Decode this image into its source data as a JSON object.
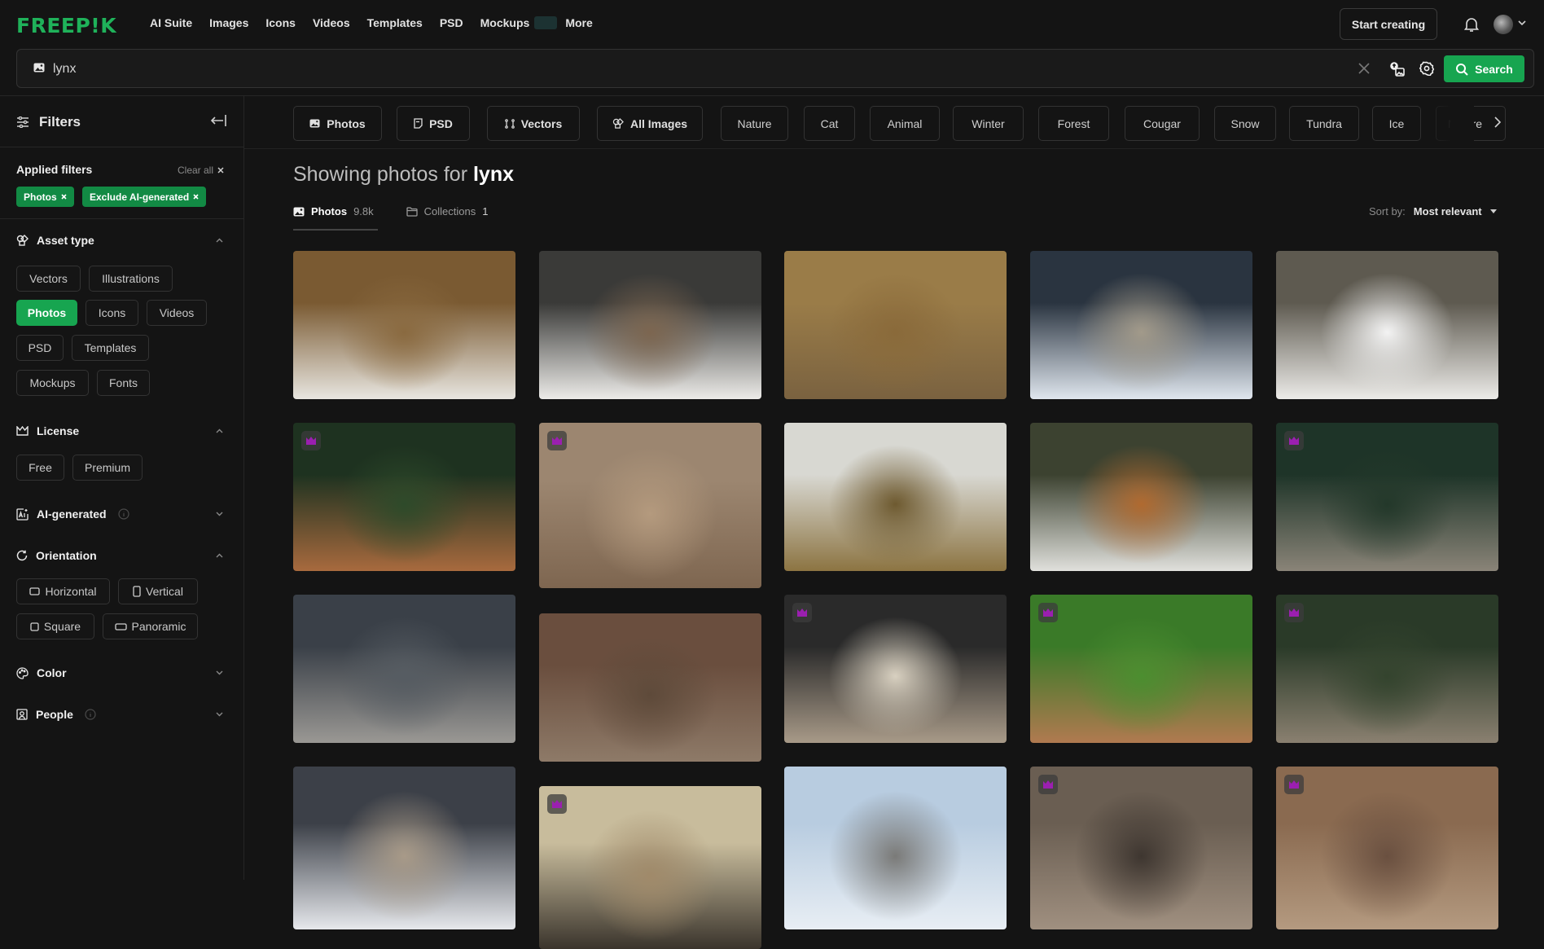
{
  "brand": {
    "logo": "FREEP!K",
    "accent": "#17a550"
  },
  "nav": {
    "links": [
      "AI Suite",
      "Images",
      "Icons",
      "Videos",
      "Templates",
      "PSD",
      "Mockups",
      "More"
    ],
    "start_creating": "Start creating"
  },
  "search": {
    "value": "lynx",
    "button_label": "Search"
  },
  "sidebar": {
    "title": "Filters",
    "applied_title": "Applied filters",
    "clear_all": "Clear all",
    "applied_chips": [
      "Photos",
      "Exclude AI-generated"
    ],
    "asset_type": {
      "title": "Asset type",
      "options": [
        "Vectors",
        "Illustrations",
        "Photos",
        "Icons",
        "Videos",
        "PSD",
        "Templates",
        "Mockups",
        "Fonts"
      ],
      "selected": "Photos"
    },
    "license": {
      "title": "License",
      "options": [
        "Free",
        "Premium"
      ]
    },
    "ai_generated": {
      "title": "AI-generated"
    },
    "orientation": {
      "title": "Orientation",
      "options": [
        "Horizontal",
        "Vertical",
        "Square",
        "Panoramic"
      ]
    },
    "color": {
      "title": "Color"
    },
    "people": {
      "title": "People"
    }
  },
  "tags": {
    "type_tags": [
      "Photos",
      "PSD",
      "Vectors",
      "All Images"
    ],
    "related": [
      "Nature",
      "Cat",
      "Animal",
      "Winter",
      "Forest",
      "Cougar",
      "Snow",
      "Tundra",
      "Ice",
      "Nature"
    ]
  },
  "results": {
    "title_prefix": "Showing photos for",
    "query": "lynx",
    "tabs": [
      {
        "label": "Photos",
        "count": "9.8k"
      },
      {
        "label": "Collections",
        "count": "1"
      }
    ],
    "sort_label": "Sort by:",
    "sort_value": "Most relevant"
  },
  "photos": [
    {
      "desc": "lynx lying in snowy autumn grass",
      "premium": false,
      "colors": [
        "#7a5a32",
        "#e8e6e0",
        "#8a6a40"
      ]
    },
    {
      "desc": "lynx resting on snow",
      "premium": false,
      "colors": [
        "#3a3a38",
        "#ecebe8",
        "#7c6650"
      ]
    },
    {
      "desc": "lynx lying on dry grass",
      "premium": false,
      "colors": [
        "#9a7c48",
        "#7a6240",
        "#8a6a3a"
      ]
    },
    {
      "desc": "lynx in snowy forest",
      "premium": false,
      "colors": [
        "#2a3440",
        "#dfe6ee",
        "#a29a8a"
      ]
    },
    {
      "desc": "lynx walking in snow",
      "premium": false,
      "colors": [
        "#5e5a50",
        "#ecebe8",
        "#f3f3f3"
      ]
    },
    {
      "desc": "lynx portrait with ivy",
      "premium": true,
      "colors": [
        "#1e3220",
        "#a86a3e",
        "#2e4a2a"
      ]
    },
    {
      "desc": "lynx licking lips close-up",
      "premium": true,
      "colors": [
        "#9c8670",
        "#7e6650",
        "#b49a7e"
      ]
    },
    {
      "desc": "lynx sitting in meadow",
      "premium": false,
      "colors": [
        "#d8d8d2",
        "#8c7442",
        "#6e5a30"
      ]
    },
    {
      "desc": "lynx sitting on snowy rock in forest",
      "premium": false,
      "colors": [
        "#3c4230",
        "#e0e0dc",
        "#b06a30"
      ]
    },
    {
      "desc": "lynx portrait dark green background",
      "premium": true,
      "colors": [
        "#1e3428",
        "#8a8478",
        "#23382a"
      ]
    },
    {
      "desc": "bobcat in forest",
      "premium": false,
      "colors": [
        "#3a4048",
        "#9a9894",
        "#565c62"
      ]
    },
    {
      "desc": "bobcat behind log",
      "premium": false,
      "colors": [
        "#6a4e3e",
        "#8e7a68",
        "#5e4a3a"
      ]
    },
    {
      "desc": "lynx sitting near tree",
      "premium": true,
      "colors": [
        "#2a2a2a",
        "#a89a88",
        "#d8d0c0"
      ]
    },
    {
      "desc": "lynx lying in green grass",
      "premium": true,
      "colors": [
        "#3a7a28",
        "#b07a50",
        "#4c8e30"
      ]
    },
    {
      "desc": "lynx portrait in forest",
      "premium": true,
      "colors": [
        "#2a3a28",
        "#8a8070",
        "#34442e"
      ]
    },
    {
      "desc": "lynx in snowy spruce forest",
      "premium": false,
      "colors": [
        "#3c4048",
        "#e6e8ec",
        "#a89a88"
      ]
    },
    {
      "desc": "lynx among tree trunks",
      "premium": true,
      "colors": [
        "#c8bc9c",
        "#3a342c",
        "#a08a6a"
      ]
    },
    {
      "desc": "lynx in winter snow",
      "premium": false,
      "colors": [
        "#b8cce0",
        "#e8eef4",
        "#7a7a78"
      ]
    },
    {
      "desc": "lynx close portrait",
      "premium": true,
      "colors": [
        "#6a5e52",
        "#a09080",
        "#3e3630"
      ]
    },
    {
      "desc": "lynx close-up with snow",
      "premium": true,
      "colors": [
        "#8a6a50",
        "#b49a80",
        "#6a5040"
      ]
    }
  ]
}
